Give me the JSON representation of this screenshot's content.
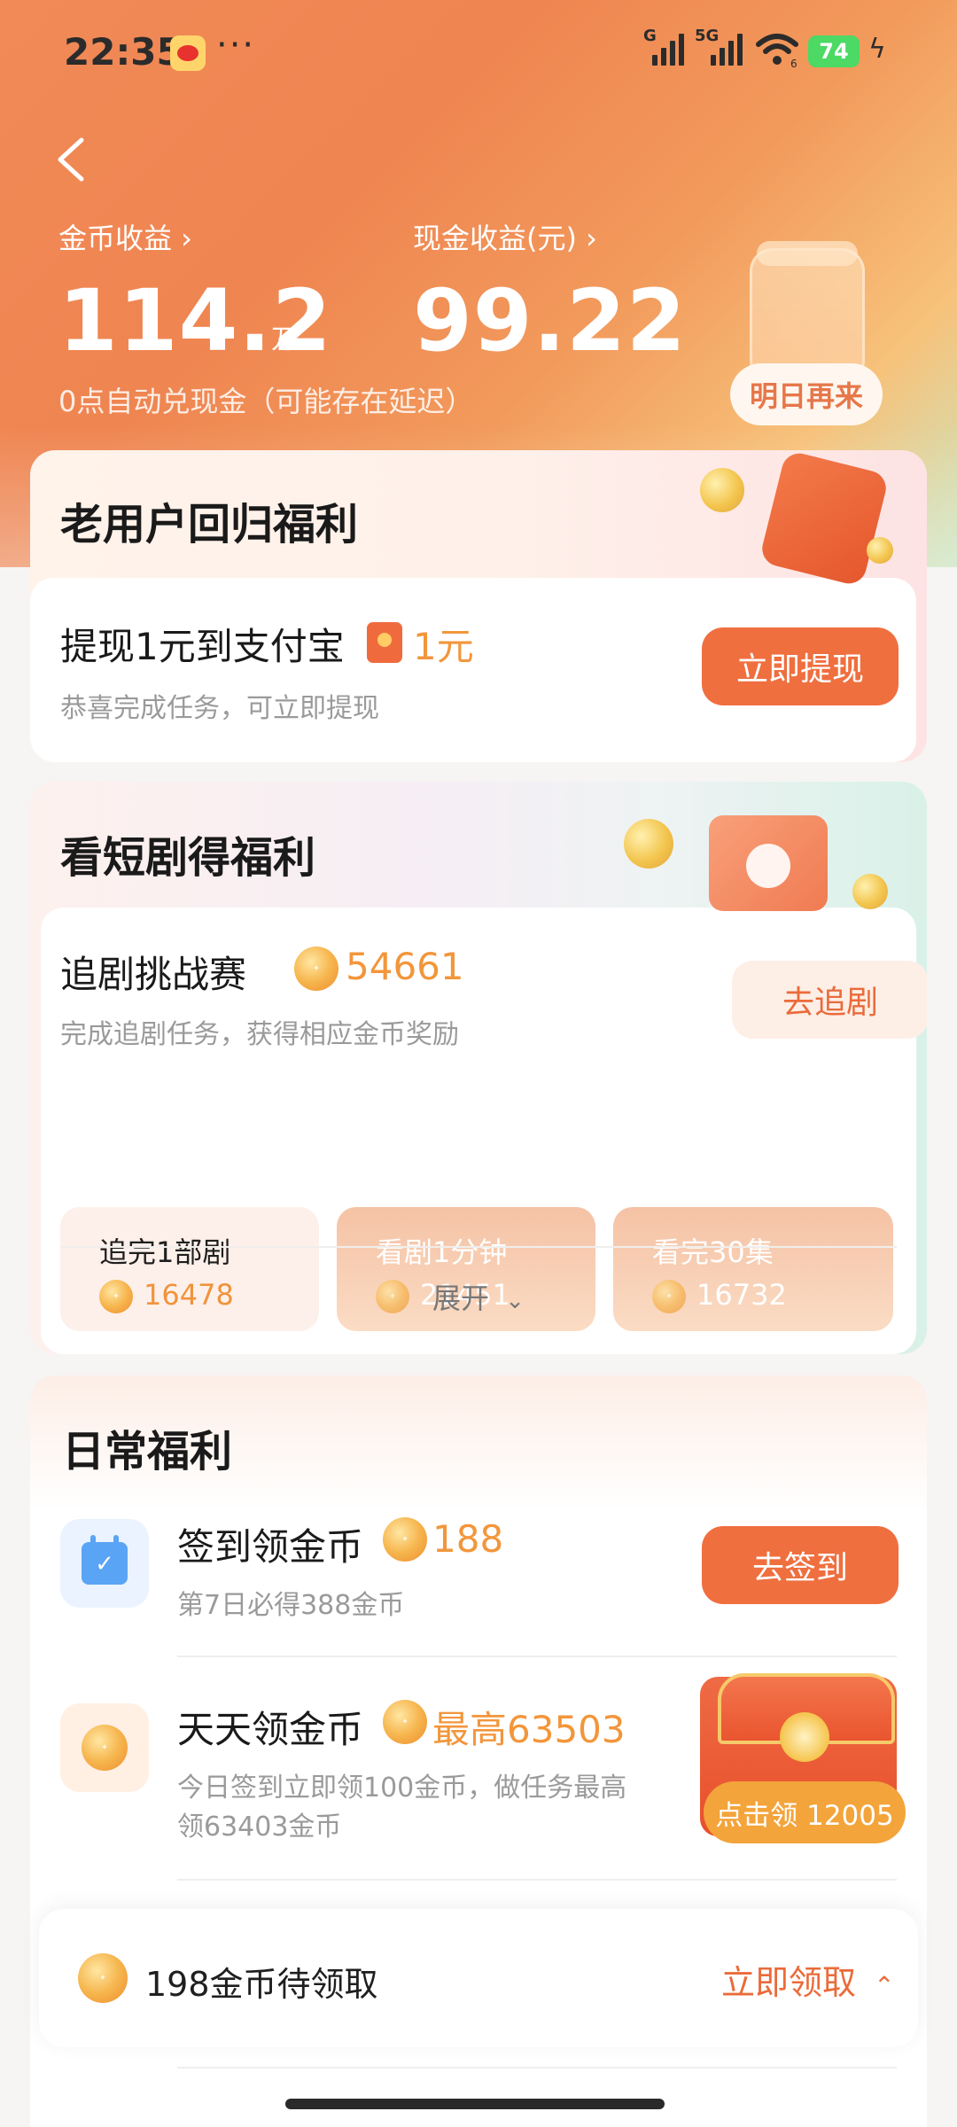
{
  "status_bar": {
    "time": "22:35",
    "signal1_label": "G",
    "signal2_label": "5G",
    "wifi_label": "6",
    "battery": "74"
  },
  "header": {
    "coin_label": "金币收益 ›",
    "coin_value": "114.2",
    "coin_unit": "万",
    "cash_label": "现金收益(元) ›",
    "cash_value": "99.22",
    "auto_note": "0点自动兑现金（可能存在延迟）",
    "tomorrow_button": "明日再来"
  },
  "returning_user": {
    "title": "老用户回归福利",
    "task_title": "提现1元到支付宝",
    "reward": "1元",
    "subtitle": "恭喜完成任务，可立即提现",
    "button": "立即提现"
  },
  "short_drama": {
    "title": "看短剧得福利",
    "challenge_title": "追剧挑战赛",
    "challenge_reward": "54661",
    "challenge_sub": "完成追剧任务，获得相应金币奖励",
    "button": "去追剧",
    "tasks": [
      {
        "label": "追完1部剧",
        "value": "16478"
      },
      {
        "label": "看剧1分钟",
        "value": "21451"
      },
      {
        "label": "看完30集",
        "value": "16732"
      }
    ],
    "expand": "展开"
  },
  "daily": {
    "title": "日常福利",
    "checkin_title": "签到领金币",
    "checkin_reward": "188",
    "checkin_sub": "第7日必得388金币",
    "checkin_button": "去签到",
    "daily_coin_title": "天天领金币",
    "daily_coin_reward": "最高63503",
    "daily_coin_sub_line1": "今日签到立即领100金币，做任务最高",
    "daily_coin_sub_line2": "领63403金币",
    "claim_pill": "点击领 12005"
  },
  "bottom_bar": {
    "pending_text": "198金币待领取",
    "claim_button": "立即领取"
  },
  "colors": {
    "accent": "#ef6f3f",
    "coin_orange": "#f2963b",
    "hero_start": "#f18a57"
  }
}
